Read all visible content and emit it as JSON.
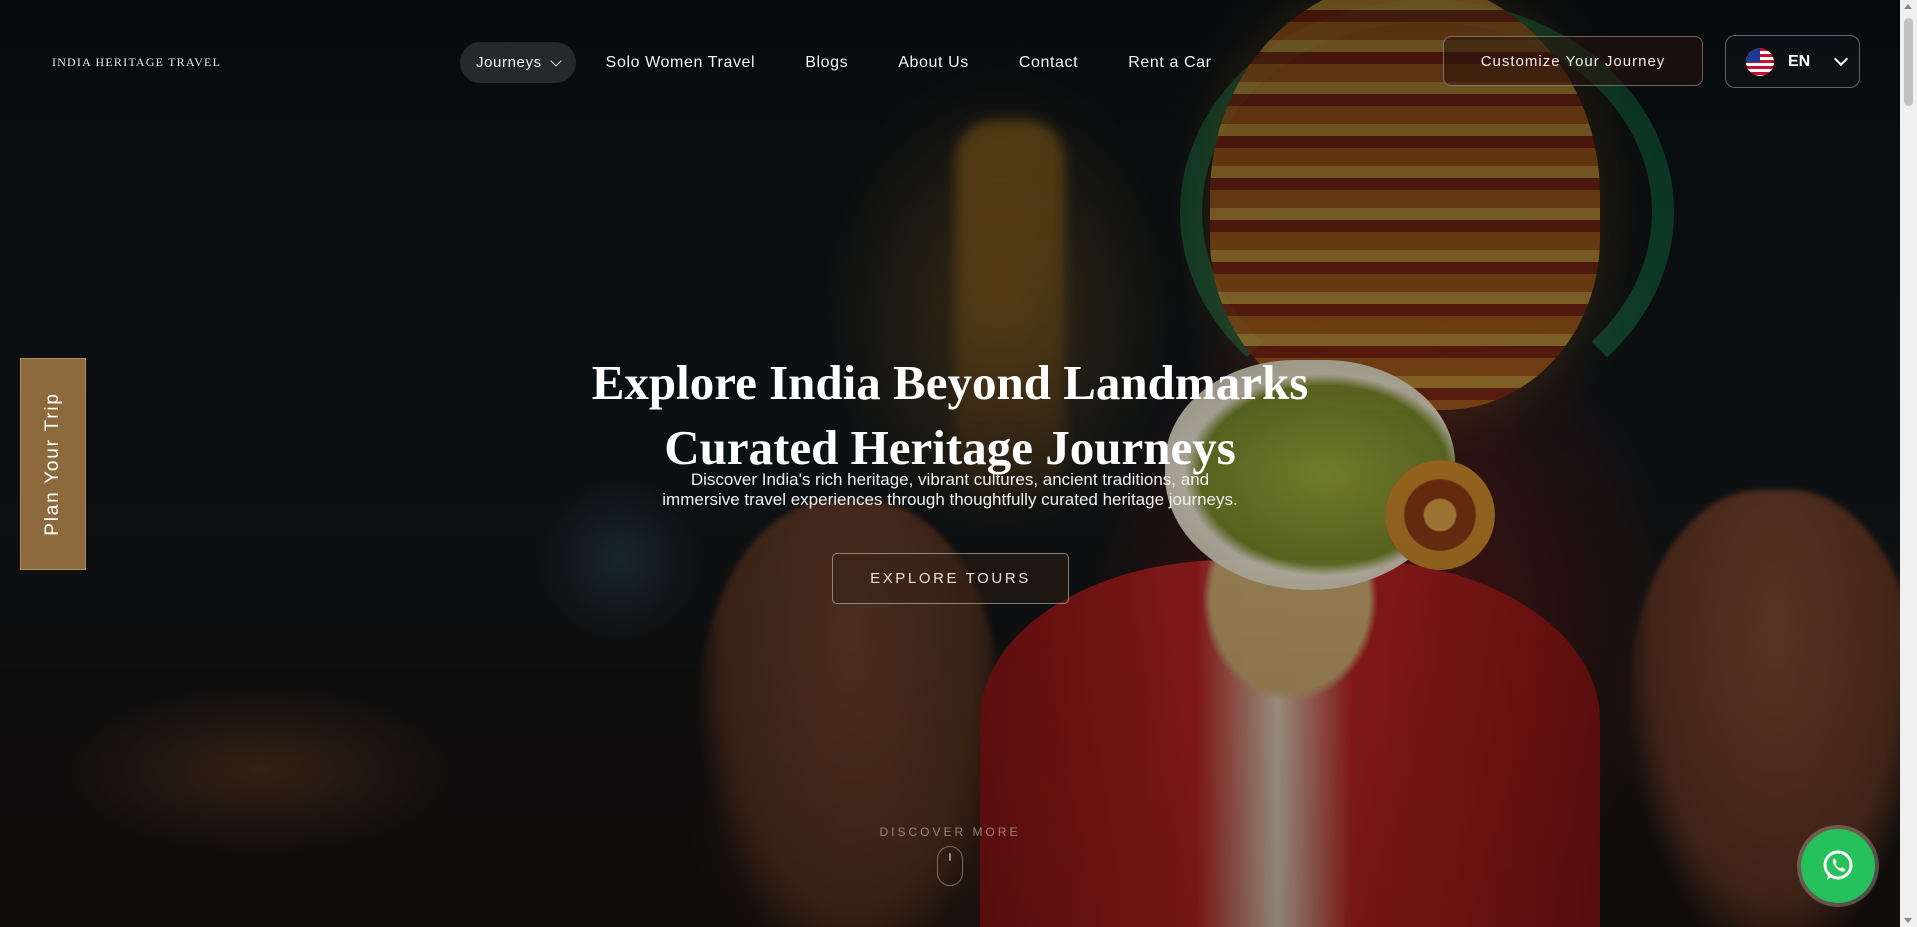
{
  "brand": {
    "name": "INDIA HERITAGE TRAVEL"
  },
  "nav": {
    "items": [
      {
        "label": "Journeys"
      },
      {
        "label": "Solo Women Travel"
      },
      {
        "label": "Blogs"
      },
      {
        "label": "About Us"
      },
      {
        "label": "Contact"
      },
      {
        "label": "Rent a Car"
      }
    ],
    "customize_label": "Customize Your Journey",
    "language": "EN"
  },
  "side_tab": {
    "label": "Plan Your Trip"
  },
  "hero": {
    "title_line1": "Explore India Beyond Landmarks",
    "title_line2": "Curated Heritage Journeys",
    "subtitle": "Discover India's rich heritage, vibrant cultures, ancient traditions, and immersive travel experiences through thoughtfully curated heritage journeys.",
    "cta_label": "EXPLORE TOURS",
    "scroll_hint": "DISCOVER MORE"
  },
  "icons": {
    "language_flag": "us-flag-icon",
    "dropdown": "chevron-down-icon",
    "whatsapp": "whatsapp-icon",
    "scroll": "mouse-scroll-icon"
  },
  "colors": {
    "side_tab_bg": "#8c6a3d",
    "whatsapp_green": "#25c15b"
  }
}
